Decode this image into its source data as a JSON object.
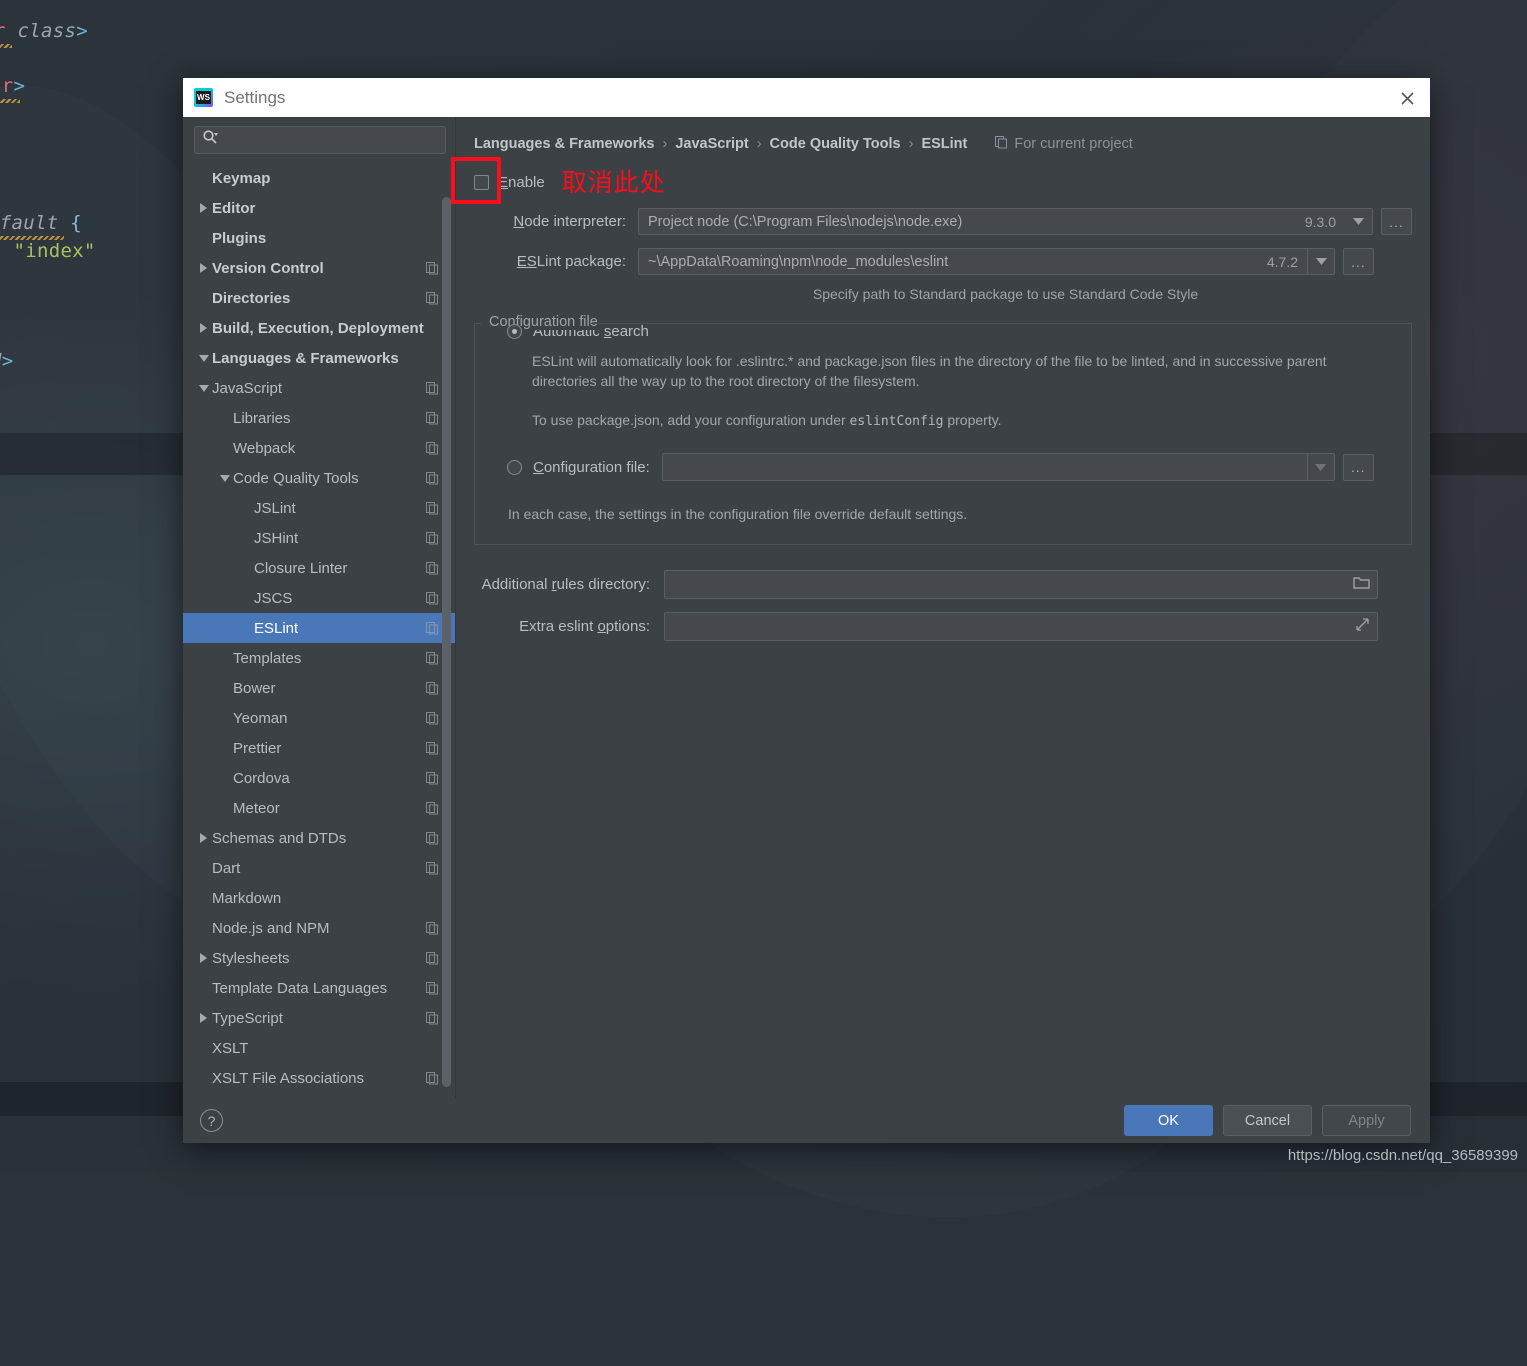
{
  "background": {
    "code_lines": [
      {
        "segments": [
          {
            "text": "r ",
            "cls": "tk-pink"
          },
          {
            "text": "class",
            "cls": "tk-ital"
          },
          {
            "text": ">",
            "cls": "tk-blue"
          }
        ]
      },
      {
        "segments": [
          {
            "text": "ar",
            "cls": "tk-pink"
          },
          {
            "text": ">",
            "cls": "tk-blue"
          }
        ]
      },
      {
        "segments": [
          {
            "text": "efault ",
            "cls": "tk-ital"
          },
          {
            "text": "{",
            "cls": "tk-brace"
          }
        ]
      },
      {
        "segments": [
          {
            "text": ": ",
            "cls": "tk-blue"
          },
          {
            "text": "\"index\"",
            "cls": "tk-str"
          }
        ]
      },
      {
        "segments": [
          {
            "text": "d",
            "cls": "tk-ital"
          },
          {
            "text": ">",
            "cls": "tk-blue"
          }
        ]
      }
    ]
  },
  "dialog": {
    "title": "Settings",
    "icon": "webstorm-icon",
    "close_icon": "close-icon"
  },
  "search": {
    "value": "",
    "placeholder": "",
    "icon": "search-icon"
  },
  "sidebar": {
    "items": [
      {
        "label": "Keymap",
        "indent": 1,
        "twisty": "",
        "copy": false,
        "bold": true,
        "selected": false
      },
      {
        "label": "Editor",
        "indent": 0,
        "twisty": "right",
        "copy": false,
        "bold": true,
        "selected": false
      },
      {
        "label": "Plugins",
        "indent": 1,
        "twisty": "",
        "copy": false,
        "bold": true,
        "selected": false
      },
      {
        "label": "Version Control",
        "indent": 0,
        "twisty": "right",
        "copy": true,
        "bold": true,
        "selected": false
      },
      {
        "label": "Directories",
        "indent": 1,
        "twisty": "",
        "copy": true,
        "bold": true,
        "selected": false
      },
      {
        "label": "Build, Execution, Deployment",
        "indent": 0,
        "twisty": "right",
        "copy": false,
        "bold": true,
        "selected": false
      },
      {
        "label": "Languages & Frameworks",
        "indent": 0,
        "twisty": "down",
        "copy": false,
        "bold": true,
        "selected": false
      },
      {
        "label": "JavaScript",
        "indent": 1,
        "twisty": "down",
        "copy": true,
        "bold": false,
        "selected": false
      },
      {
        "label": "Libraries",
        "indent": 2,
        "twisty": "",
        "copy": true,
        "bold": false,
        "selected": false
      },
      {
        "label": "Webpack",
        "indent": 2,
        "twisty": "",
        "copy": true,
        "bold": false,
        "selected": false
      },
      {
        "label": "Code Quality Tools",
        "indent": 2,
        "twisty": "down",
        "copy": true,
        "bold": false,
        "selected": false
      },
      {
        "label": "JSLint",
        "indent": 3,
        "twisty": "",
        "copy": true,
        "bold": false,
        "selected": false
      },
      {
        "label": "JSHint",
        "indent": 3,
        "twisty": "",
        "copy": true,
        "bold": false,
        "selected": false
      },
      {
        "label": "Closure Linter",
        "indent": 3,
        "twisty": "",
        "copy": true,
        "bold": false,
        "selected": false
      },
      {
        "label": "JSCS",
        "indent": 3,
        "twisty": "",
        "copy": true,
        "bold": false,
        "selected": false
      },
      {
        "label": "ESLint",
        "indent": 3,
        "twisty": "",
        "copy": true,
        "bold": false,
        "selected": true
      },
      {
        "label": "Templates",
        "indent": 2,
        "twisty": "",
        "copy": true,
        "bold": false,
        "selected": false
      },
      {
        "label": "Bower",
        "indent": 2,
        "twisty": "",
        "copy": true,
        "bold": false,
        "selected": false
      },
      {
        "label": "Yeoman",
        "indent": 2,
        "twisty": "",
        "copy": true,
        "bold": false,
        "selected": false
      },
      {
        "label": "Prettier",
        "indent": 2,
        "twisty": "",
        "copy": true,
        "bold": false,
        "selected": false
      },
      {
        "label": "Cordova",
        "indent": 2,
        "twisty": "",
        "copy": true,
        "bold": false,
        "selected": false
      },
      {
        "label": "Meteor",
        "indent": 2,
        "twisty": "",
        "copy": true,
        "bold": false,
        "selected": false
      },
      {
        "label": "Schemas and DTDs",
        "indent": 1,
        "twisty": "right",
        "copy": true,
        "bold": false,
        "selected": false
      },
      {
        "label": "Dart",
        "indent": 1,
        "twisty": "",
        "copy": true,
        "bold": false,
        "selected": false
      },
      {
        "label": "Markdown",
        "indent": 1,
        "twisty": "",
        "copy": false,
        "bold": false,
        "selected": false
      },
      {
        "label": "Node.js and NPM",
        "indent": 1,
        "twisty": "",
        "copy": true,
        "bold": false,
        "selected": false
      },
      {
        "label": "Stylesheets",
        "indent": 1,
        "twisty": "right",
        "copy": true,
        "bold": false,
        "selected": false
      },
      {
        "label": "Template Data Languages",
        "indent": 1,
        "twisty": "",
        "copy": true,
        "bold": false,
        "selected": false
      },
      {
        "label": "TypeScript",
        "indent": 1,
        "twisty": "right",
        "copy": true,
        "bold": false,
        "selected": false
      },
      {
        "label": "XSLT",
        "indent": 1,
        "twisty": "",
        "copy": false,
        "bold": false,
        "selected": false
      },
      {
        "label": "XSLT File Associations",
        "indent": 1,
        "twisty": "",
        "copy": true,
        "bold": false,
        "selected": false
      }
    ]
  },
  "main": {
    "breadcrumb": [
      "Languages & Frameworks",
      "JavaScript",
      "Code Quality Tools",
      "ESLint"
    ],
    "breadcrumb_separator": "›",
    "for_current_project": "For current project",
    "for_current_project_icon": "copy-icon",
    "enable": {
      "label_prefix": "E",
      "label_rest": "nable",
      "checked": false
    },
    "annotation": "取消此处",
    "annotation_color": "#fc0d1b",
    "node_interpreter": {
      "label_prefix": "N",
      "label_rest": "ode interpreter:",
      "value": "Project  node (C:\\Program Files\\nodejs\\node.exe)",
      "version": "9.3.0",
      "browse_label": "..."
    },
    "eslint_package": {
      "label_prefix": "ES",
      "label_rest": "Lint package:",
      "value": "~\\AppData\\Roaming\\npm\\node_modules\\eslint",
      "version": "4.7.2",
      "browse_label": "..."
    },
    "standard_hint": "Specify path to Standard package to use Standard Code Style",
    "config_group": {
      "title": "Configuration file",
      "automatic_search": {
        "label_prefix": "Automatic ",
        "label_underlined": "s",
        "label_rest": "earch",
        "selected": true
      },
      "auto_description": "ESLint will automatically look for .eslintrc.* and package.json files in the directory of the file to be linted, and in successive parent directories all the way up to the root directory of the filesystem.",
      "package_note_before": "To use package.json, add your configuration under ",
      "package_note_code": "eslintConfig",
      "package_note_after": " property.",
      "configuration_file": {
        "label_prefix": "C",
        "label_rest": "onfiguration file:",
        "value": "",
        "selected": false,
        "browse_label": "..."
      },
      "override_note": "In each case, the settings in the configuration file override default settings."
    },
    "additional_rules_directory": {
      "label_a": "Additional ",
      "label_u": "r",
      "label_b": "ules directory:",
      "value": "",
      "icon": "folder-icon"
    },
    "extra_eslint_options": {
      "label_a": "Extra eslint ",
      "label_u": "o",
      "label_b": "ptions:",
      "value": "",
      "icon": "expand-icon"
    }
  },
  "footer": {
    "help_label": "?",
    "help_icon": "help-icon",
    "ok": "OK",
    "cancel": "Cancel",
    "apply": "Apply",
    "apply_disabled": true,
    "primary_color": "#4a77b8"
  },
  "watermark": "https://blog.csdn.net/qq_36589399"
}
